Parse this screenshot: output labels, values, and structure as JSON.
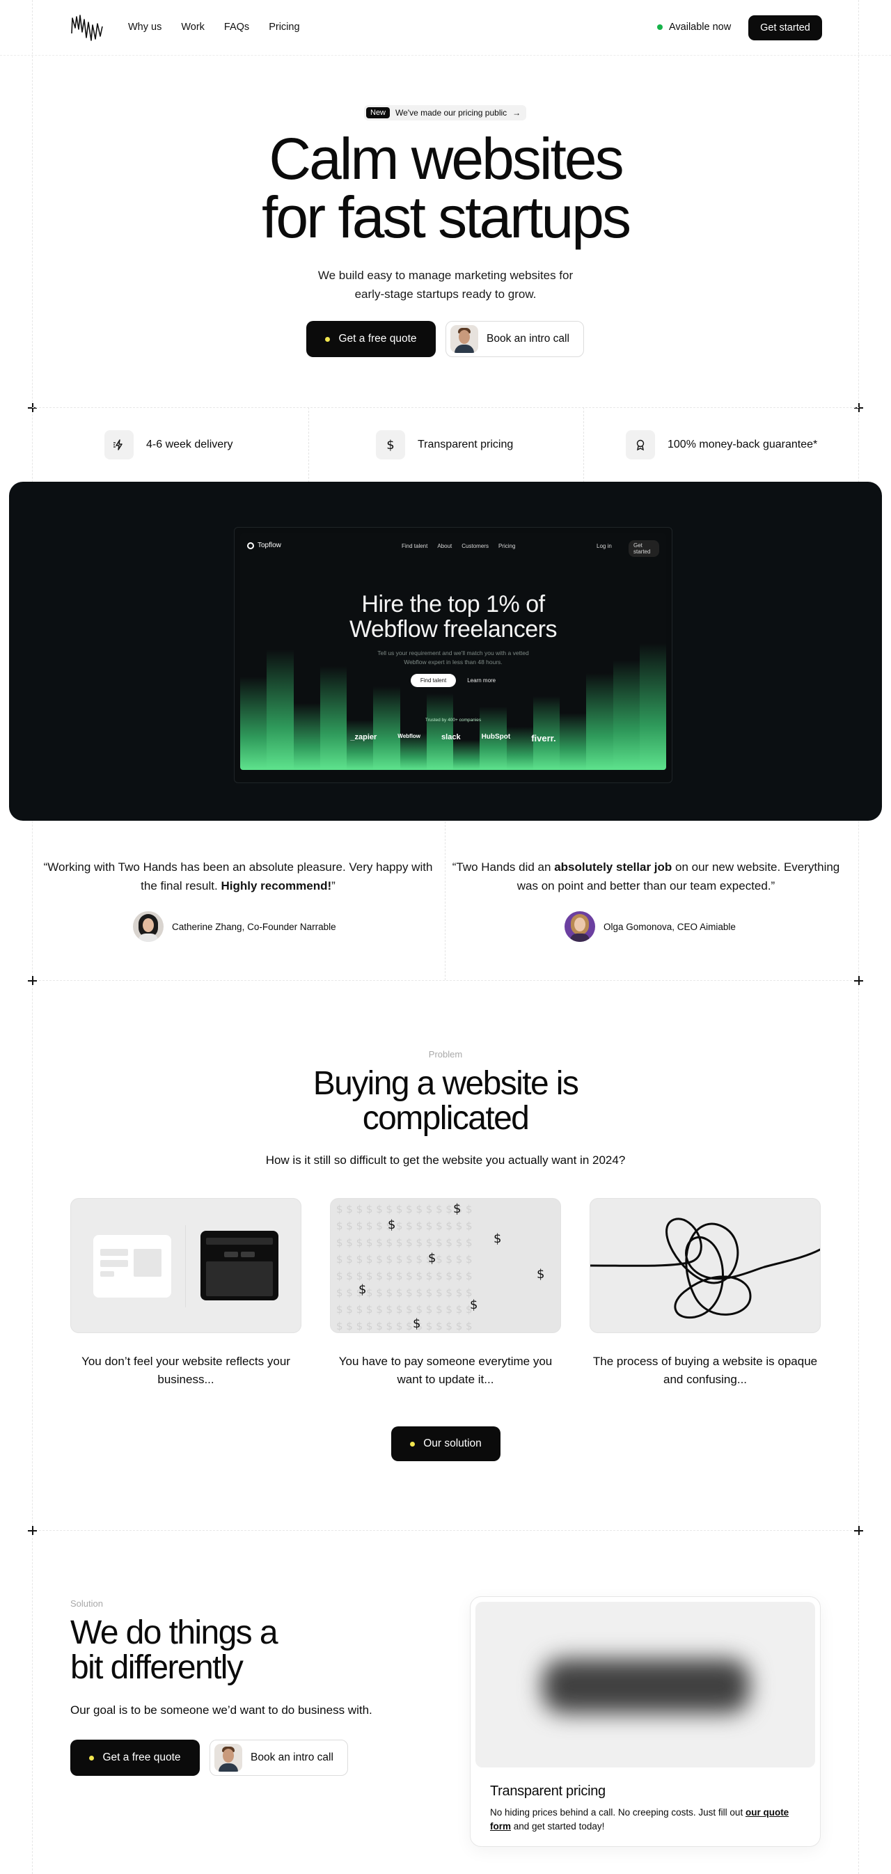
{
  "nav": {
    "links": [
      "Why us",
      "Work",
      "FAQs",
      "Pricing"
    ],
    "status": "Available now",
    "cta": "Get started"
  },
  "hero": {
    "badge_new": "New",
    "badge_text": "We've made our pricing public",
    "badge_arrow": "→",
    "title_line1": "Calm websites",
    "title_line2": "for fast startups",
    "subtitle_line1": "We build easy to manage marketing websites for",
    "subtitle_line2": "early-stage startups ready to grow.",
    "primary_cta": "Get a free quote",
    "secondary_cta": "Book an intro call"
  },
  "features": [
    {
      "label": "4-6 week delivery",
      "icon": "lightning-icon"
    },
    {
      "label": "Transparent pricing",
      "icon": "dollar-icon"
    },
    {
      "label": "100% money-back guarantee*",
      "icon": "award-icon"
    }
  ],
  "showcase": {
    "brand": "Topflow",
    "nav_links": [
      "Find talent",
      "About",
      "Customers",
      "Pricing"
    ],
    "login": "Log in",
    "cta": "Get started",
    "title_line1": "Hire the top 1% of",
    "title_line2": "Webflow freelancers",
    "sub_line1": "Tell us your requirement and we'll match you with a vetted",
    "sub_line2": "Webflow expert in less than 48 hours.",
    "primary": "Find talent",
    "secondary": "Learn more",
    "trusted": "Trusted by 400+ companies",
    "logos": [
      "_zapier",
      "Webflow",
      "slack",
      "HubSpot",
      "fiverr."
    ],
    "green": "#5ee38d"
  },
  "testimonials": [
    {
      "quote_a": "“Working with Two Hands has been an absolute pleasure. Very happy with the final result. ",
      "quote_b": "Highly recommend!",
      "quote_c": "”",
      "author": "Catherine Zhang, Co-Founder Narrable"
    },
    {
      "quote_a": "“Two Hands did an ",
      "quote_b": "absolutely stellar job",
      "quote_c": " on our new website. Everything was on point and better than our team expected.”",
      "author": "Olga Gomonova, CEO Aimiable"
    }
  ],
  "problem": {
    "eyebrow": "Problem",
    "title_line1": "Buying a website is",
    "title_line2": "complicated",
    "subtitle": "How is it still so difficult to get the website you actually want in 2024?",
    "cards": [
      {
        "caption": "You don’t feel your website reflects your business..."
      },
      {
        "caption": "You have to pay someone everytime you want to update it..."
      },
      {
        "caption": "The process of buying a website is opaque and confusing..."
      }
    ],
    "cta": "Our solution"
  },
  "solution": {
    "eyebrow": "Solution",
    "title_line1": "We do things a",
    "title_line2": "bit differently",
    "subtitle": "Our goal is to be someone we’d want to do business with.",
    "primary_cta": "Get a free quote",
    "secondary_cta": "Book an intro call",
    "card_title": "Transparent pricing",
    "card_text_a": "No hiding prices behind a call. No creeping costs. Just fill out ",
    "card_link": "our quote form",
    "card_text_b": " and get started today!"
  }
}
